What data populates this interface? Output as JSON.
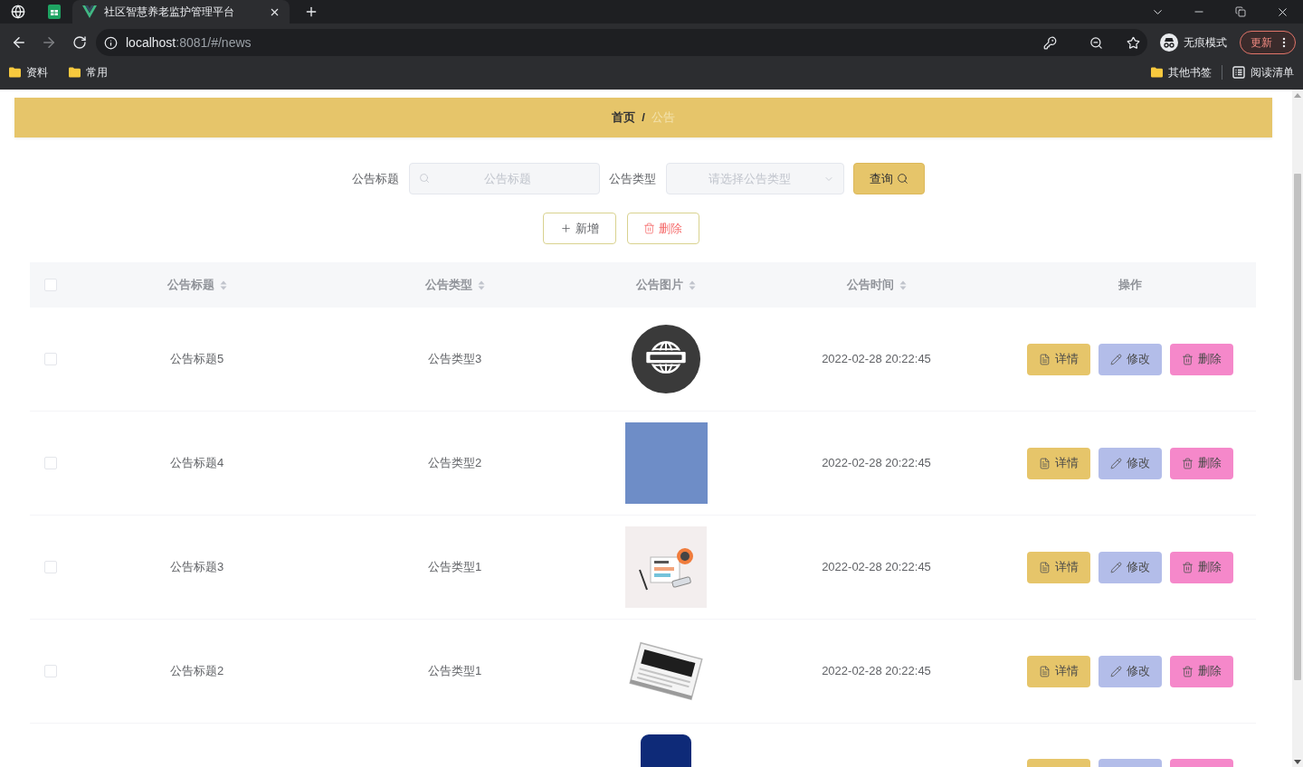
{
  "browser": {
    "tab": {
      "title": "社区智慧养老监护管理平台"
    },
    "address": {
      "host": "localhost",
      "path": ":8081/#/news"
    },
    "profile": {
      "label": "无痕模式"
    },
    "update_button": {
      "label": "更新"
    },
    "bookmarks": [
      {
        "label": "资料",
        "kind": "folder"
      },
      {
        "label": "常用",
        "kind": "folder"
      }
    ],
    "bookmarks_right": [
      {
        "label": "其他书签",
        "kind": "folder"
      },
      {
        "label": "阅读清单",
        "kind": "reading-list"
      }
    ]
  },
  "breadcrumb": {
    "items": [
      "首页",
      "公告"
    ],
    "separator": "/"
  },
  "search": {
    "fields": [
      {
        "label": "公告标题",
        "placeholder": "公告标题",
        "kind": "input"
      },
      {
        "label": "公告类型",
        "placeholder": "请选择公告类型",
        "kind": "select"
      }
    ],
    "button": "查询"
  },
  "toolbar": [
    {
      "label": "新增",
      "kind": "add"
    },
    {
      "label": "删除",
      "kind": "delete"
    }
  ],
  "table": {
    "all_checked": false,
    "columns": [
      {
        "label": "公告标题",
        "sortable": true
      },
      {
        "label": "公告类型",
        "sortable": true
      },
      {
        "label": "公告图片",
        "sortable": true
      },
      {
        "label": "公告时间",
        "sortable": true
      },
      {
        "label": "操作",
        "sortable": false
      }
    ],
    "rows": [
      {
        "checked": false,
        "title": "公告标题5",
        "type": "公告类型3",
        "picture": {
          "kind": "globe"
        },
        "time": "2022-02-28 20:22:45",
        "actions": [
          {
            "label": "详情",
            "kind": "detail"
          },
          {
            "label": "修改",
            "kind": "edit"
          },
          {
            "label": "删除",
            "kind": "delete"
          }
        ]
      },
      {
        "checked": false,
        "title": "公告标题4",
        "type": "公告类型2",
        "picture": {
          "kind": "tile"
        },
        "time": "2022-02-28 20:22:45",
        "actions": [
          {
            "label": "详情",
            "kind": "detail"
          },
          {
            "label": "修改",
            "kind": "edit"
          },
          {
            "label": "删除",
            "kind": "delete"
          }
        ]
      },
      {
        "checked": false,
        "title": "公告标题3",
        "type": "公告类型1",
        "picture": {
          "kind": "illustration"
        },
        "time": "2022-02-28 20:22:45",
        "actions": [
          {
            "label": "详情",
            "kind": "detail"
          },
          {
            "label": "修改",
            "kind": "edit"
          },
          {
            "label": "删除",
            "kind": "delete"
          }
        ]
      },
      {
        "checked": false,
        "title": "公告标题2",
        "type": "公告类型1",
        "picture": {
          "kind": "newspaper"
        },
        "time": "2022-02-28 20:22:45",
        "actions": [
          {
            "label": "详情",
            "kind": "detail"
          },
          {
            "label": "修改",
            "kind": "edit"
          },
          {
            "label": "删除",
            "kind": "delete"
          }
        ]
      }
    ],
    "partial_row": {
      "picture": {
        "kind": "partial"
      },
      "actions": [
        {
          "kind": "detail"
        },
        {
          "kind": "edit"
        },
        {
          "kind": "delete"
        }
      ]
    }
  }
}
